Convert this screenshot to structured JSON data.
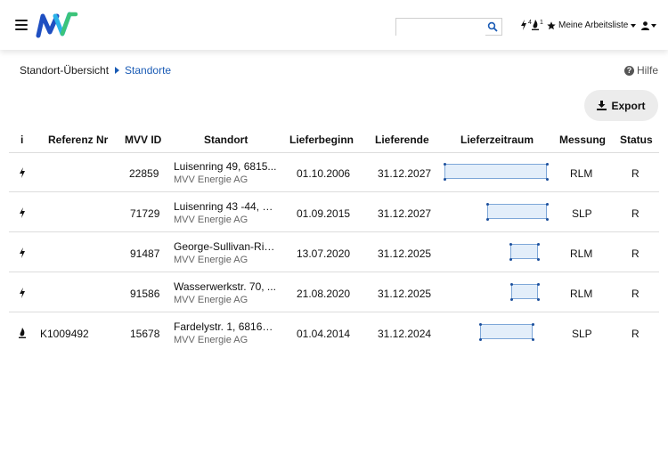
{
  "header": {
    "search_placeholder": "",
    "icons": [
      "menu-icon",
      "search-icon",
      "lightning-icon",
      "flame-icon",
      "star-icon",
      "user-icon"
    ],
    "strom_count": "4",
    "gas_count": "1",
    "worklist_label": "Meine Arbeitsliste",
    "brand_colors": {
      "blue": "#1f4fc1",
      "green": "#3cc47a",
      "cyan": "#2bb3e8"
    }
  },
  "breadcrumb": {
    "root": "Standort-Übersicht",
    "current": "Standorte"
  },
  "help_label": "Hilfe",
  "export_label": "Export",
  "table": {
    "columns": {
      "info": "i",
      "ref": "Referenz Nr",
      "mvv_id": "MVV ID",
      "standort": "Standort",
      "lieferbeginn": "Lieferbeginn",
      "lieferende": "Lieferende",
      "lieferzeitraum": "Lieferzeitraum",
      "messung": "Messung",
      "status": "Status"
    },
    "rows": [
      {
        "type": "strom",
        "ref": "",
        "mvv_id": "22859",
        "standort": "Luisenring 49, 6815...",
        "company": "MVV Energie AG",
        "lieferbeginn": "01.10.2006",
        "lieferende": "31.12.2027",
        "messung": "RLM",
        "status": "R"
      },
      {
        "type": "strom",
        "ref": "",
        "mvv_id": "71729",
        "standort": "Luisenring 43 -44, 6...",
        "company": "MVV Energie AG",
        "lieferbeginn": "01.09.2015",
        "lieferende": "31.12.2027",
        "messung": "SLP",
        "status": "R"
      },
      {
        "type": "strom",
        "ref": "",
        "mvv_id": "91487",
        "standort": "George-Sullivan-Rin...",
        "company": "MVV Energie AG",
        "lieferbeginn": "13.07.2020",
        "lieferende": "31.12.2025",
        "messung": "RLM",
        "status": "R"
      },
      {
        "type": "strom",
        "ref": "",
        "mvv_id": "91586",
        "standort": "Wasserwerkstr. 70, ...",
        "company": "MVV Energie AG",
        "lieferbeginn": "21.08.2020",
        "lieferende": "31.12.2025",
        "messung": "RLM",
        "status": "R"
      },
      {
        "type": "gas",
        "ref": "K1009492",
        "mvv_id": "15678",
        "standort": "Fardelystr. 1, 68169 ...",
        "company": "MVV Energie AG",
        "lieferbeginn": "01.04.2014",
        "lieferende": "31.12.2024",
        "messung": "SLP",
        "status": "R"
      }
    ]
  }
}
